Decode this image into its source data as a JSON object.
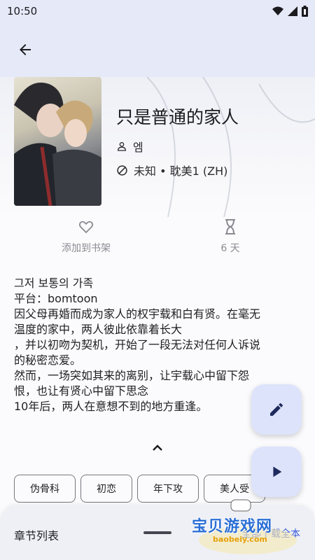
{
  "status_bar": {
    "time": "10:50"
  },
  "manga": {
    "title": "只是普通的家人",
    "author": "엠",
    "status_line": "未知 • 耽美1 (ZH)"
  },
  "actions": {
    "favorite_label": "添加到书架",
    "duration_label": "6 天"
  },
  "description": {
    "lines": [
      "그저 보통의 가족",
      "平台：bomtoon",
      "因父母再婚而成为家人的权宇载和白有贤。在毫无",
      "温度的家中，两人彼此依靠着长大",
      "，并以初吻为契机，开始了一段无法对任何人诉说",
      "的秘密恋爱。",
      "然而，一场突如其来的离别，让宇载心中留下怨",
      "恨，也让有贤心中留下思念",
      "10年后，两人在意想不到的地方重逢。"
    ]
  },
  "tags": [
    "伪骨科",
    "初恋",
    "年下攻",
    "美人受"
  ],
  "bottom_sheet": {
    "title": "章节列表",
    "action_label": "全部下载全本"
  },
  "watermark": {
    "text": "宝贝游戏网",
    "url": "baobeiy.com"
  },
  "icons": {
    "back": "arrow-back-icon",
    "person": "person-icon",
    "status": "block-icon",
    "favorite": "heart-outline-icon",
    "hourglass": "hourglass-icon",
    "expand": "chevron-up-icon",
    "edit": "pencil-icon",
    "play": "play-icon"
  },
  "colors": {
    "app_bar": "#e6e9f7",
    "fab": "#dde3fb",
    "accent": "#3b5bdb"
  }
}
